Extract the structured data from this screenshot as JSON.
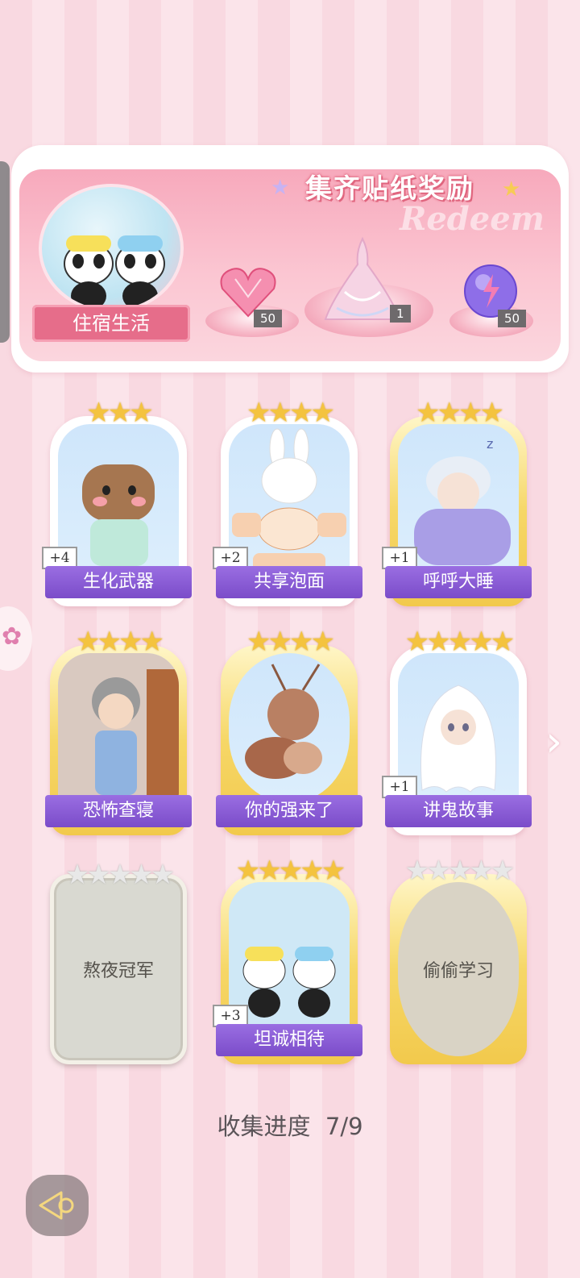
{
  "banner": {
    "title": "集齐贴纸奖励",
    "watermark": "Redeem",
    "theme_label": "住宿生活",
    "rewards": [
      {
        "icon": "pink-heart-gem-icon",
        "count": "50"
      },
      {
        "icon": "fairy-dress-icon",
        "count": "1"
      },
      {
        "icon": "purple-lightning-orb-icon",
        "count": "50"
      }
    ]
  },
  "cards": [
    {
      "label": "生化武器",
      "stars": 3,
      "plus": "+4",
      "style": "white",
      "icon": "capybara-pajama-icon"
    },
    {
      "label": "共享泡面",
      "stars": 4,
      "plus": "+2",
      "style": "white",
      "icon": "bunny-noodles-icon"
    },
    {
      "label": "呼呼大睡",
      "stars": 4,
      "plus": "+1",
      "style": "gold",
      "icon": "sleeping-boy-icon"
    },
    {
      "label": "恐怖查寝",
      "stars": 4,
      "plus": "",
      "style": "gold",
      "icon": "dorm-auntie-icon"
    },
    {
      "label": "你的强来了",
      "stars": 4,
      "plus": "",
      "style": "gold",
      "icon": "cockroach-icon"
    },
    {
      "label": "讲鬼故事",
      "stars": 5,
      "plus": "+1",
      "style": "white",
      "icon": "ghost-boy-icon"
    },
    {
      "label": "熬夜冠军",
      "stars": 5,
      "plus": "",
      "style": "locked",
      "icon": ""
    },
    {
      "label": "坦诚相待",
      "stars": 5,
      "plus": "+3",
      "style": "gold",
      "icon": "pandas-shower-icon"
    },
    {
      "label": "偷偷学习",
      "stars": 5,
      "plus": "",
      "style": "gold-locked",
      "icon": ""
    }
  ],
  "progress": {
    "label": "收集进度",
    "value": "7/9"
  },
  "colors": {
    "accent": "#e66d8a",
    "label_purple": "#7b4cc9",
    "star_gold": "#f4c33f"
  }
}
